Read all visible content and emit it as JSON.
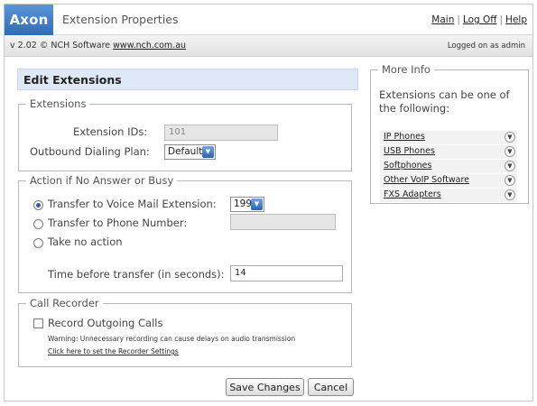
{
  "header": {
    "logo": "Axon",
    "title": "Extension Properties",
    "links": {
      "main": "Main",
      "logoff": "Log Off",
      "help": "Help"
    }
  },
  "subbar": {
    "version": "v 2.02 © NCH Software",
    "website": "www.nch.com.au",
    "logged_on": "Logged on as admin"
  },
  "page": {
    "heading": "Edit Extensions"
  },
  "extensions": {
    "legend": "Extensions",
    "ids_label": "Extension IDs:",
    "ids_value": "101",
    "dialing_label": "Outbound Dialing Plan:",
    "dialing_value": "Default"
  },
  "action": {
    "legend": "Action if No Answer or Busy",
    "voicemail_label": "Transfer to Voice Mail Extension:",
    "voicemail_value": "199",
    "phone_label": "Transfer to Phone Number:",
    "phone_value": "",
    "no_action_label": "Take no action",
    "selected": "voicemail",
    "time_label": "Time before transfer (in seconds):",
    "time_value": "14"
  },
  "recorder": {
    "legend": "Call Recorder",
    "record_label": "Record Outgoing Calls",
    "record_checked": false,
    "warning": "Warning: Unnecessary recording can cause delays on audio transmission",
    "settings_link": "Click here to set the Recorder Settings"
  },
  "buttons": {
    "save": "Save Changes",
    "cancel": "Cancel"
  },
  "more_info": {
    "legend": "More Info",
    "intro": "Extensions can be one of the following:",
    "items": [
      "IP Phones",
      "USB Phones",
      "Softphones",
      "Other VoIP Software",
      "FXS Adapters"
    ]
  }
}
